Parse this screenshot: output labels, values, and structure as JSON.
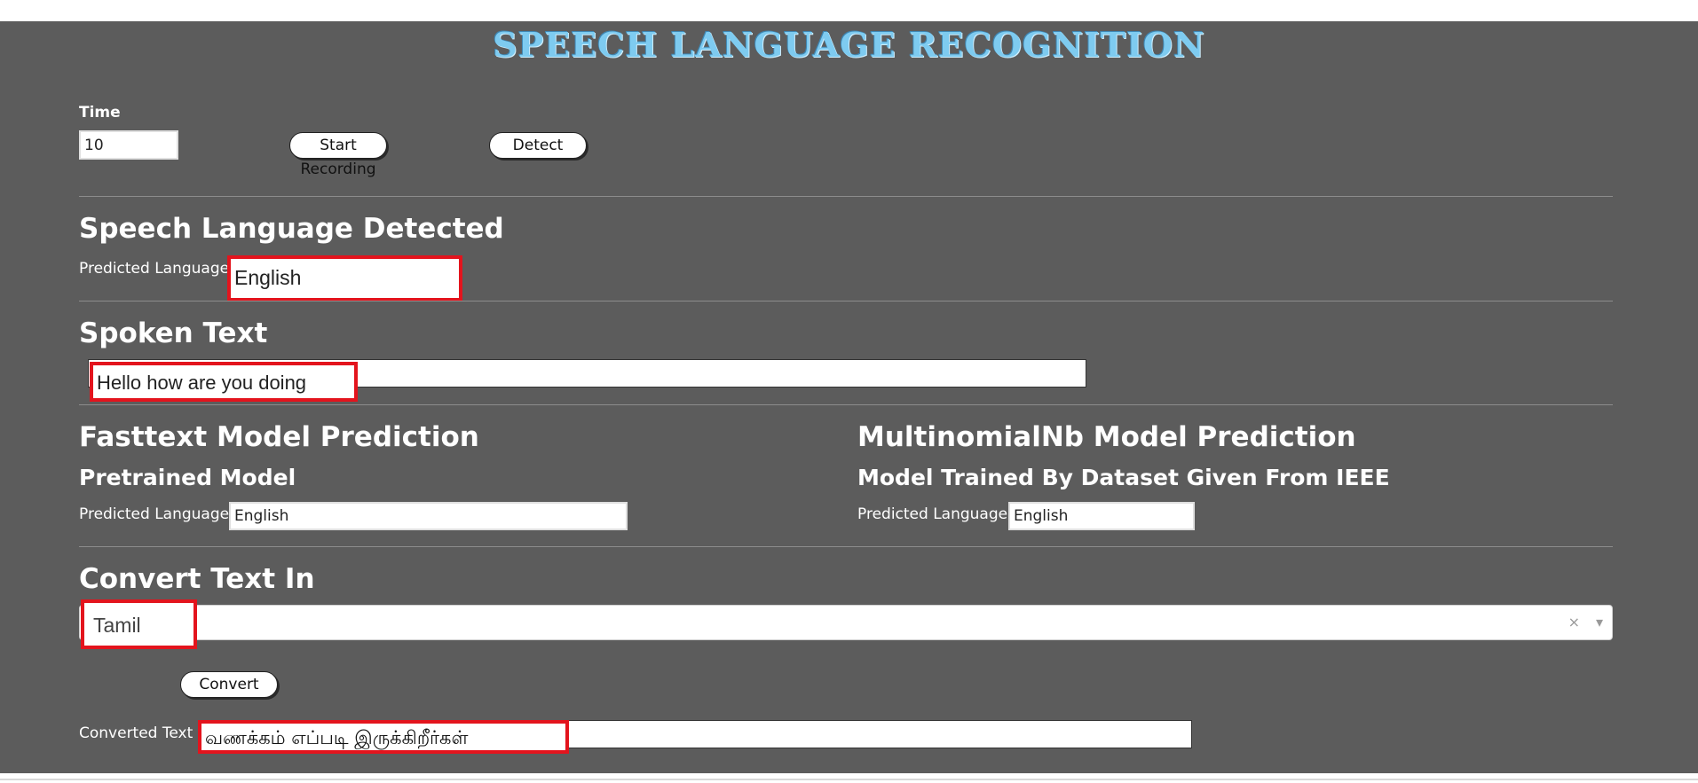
{
  "header": {
    "title": "SPEECH LANGUAGE RECOGNITION"
  },
  "recorder": {
    "time_label": "Time",
    "time_value": "10",
    "start_label": "Start",
    "recording_label": "Recording",
    "detect_label": "Detect"
  },
  "speech_detect": {
    "heading": "Speech Language Detected",
    "predicted_label": "Predicted Language",
    "predicted_value": "English"
  },
  "spoken": {
    "heading": "Spoken Text",
    "value": "Hello how are you doing"
  },
  "fasttext": {
    "heading": "Fasttext Model Prediction",
    "subheading": "Pretrained Model",
    "predicted_label": "Predicted Language",
    "predicted_value": "English"
  },
  "multinomial": {
    "heading": "MultinomialNb Model Prediction",
    "subheading": "Model Trained By Dataset Given From IEEE",
    "predicted_label": "Predicted Language",
    "predicted_value": "English"
  },
  "convert": {
    "heading": "Convert Text In",
    "selected_language": "Tamil",
    "clear_glyph": "×",
    "caret_glyph": "▾",
    "convert_label": "Convert",
    "converted_label": "Converted Text",
    "converted_value": "வணக்கம் எப்படி இருக்கிறீர்கள்"
  },
  "colors": {
    "background": "#5c5c5c",
    "title": "#7ecbf0",
    "highlight": "#e3141d"
  }
}
